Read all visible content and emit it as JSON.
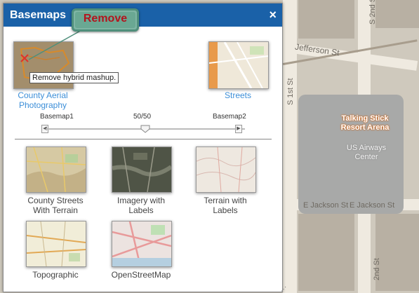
{
  "map": {
    "streets": [
      "Jefferson St",
      "S 2nd St",
      "S 1st St",
      "E Jackson St",
      "E Jackson St",
      "2nd St"
    ],
    "arena": [
      "Talking Stick",
      "Resort Arena"
    ],
    "arena_sub": [
      "US Airways",
      "Center"
    ]
  },
  "panel": {
    "title": "Basemaps",
    "close_label": "×"
  },
  "callout": {
    "label": "Remove"
  },
  "tooltip": {
    "text": "Remove hybrid mashup."
  },
  "active_basemaps": [
    {
      "label_line1": "County Aerial",
      "label_line2": "Photography"
    },
    {
      "label_line1": "Streets",
      "label_line2": ""
    }
  ],
  "slider": {
    "left_label": "Basemap1",
    "value_label": "50/50",
    "right_label": "Basemap2",
    "value": 0.5,
    "left_icon": "step-left-icon",
    "right_icon": "step-right-icon"
  },
  "gallery": [
    {
      "line1": "County Streets",
      "line2": "With Terrain"
    },
    {
      "line1": "Imagery with",
      "line2": "Labels"
    },
    {
      "line1": "Terrain with",
      "line2": "Labels"
    },
    {
      "line1": "Topographic",
      "line2": ""
    },
    {
      "line1": "OpenStreetMap",
      "line2": ""
    }
  ],
  "colors": {
    "titlebar": "#1a61a8",
    "remove_text": "#b3141d",
    "link_blue": "#3d8fd8"
  }
}
